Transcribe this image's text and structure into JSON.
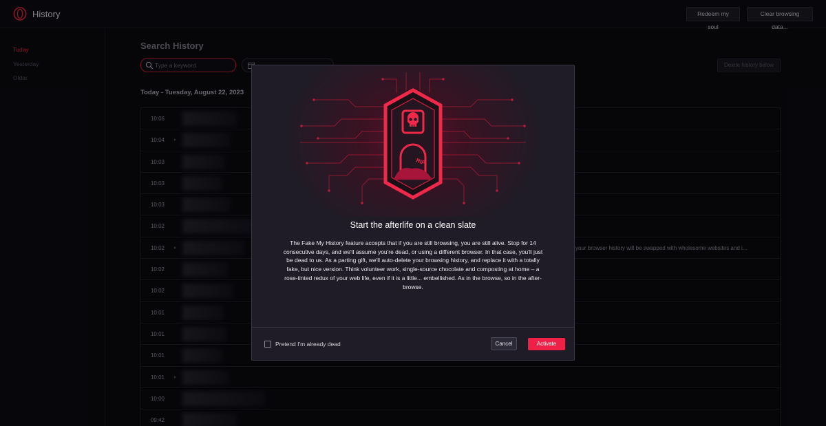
{
  "header": {
    "title": "History",
    "redeem_label": "Redeem my soul",
    "clear_label": "Clear browsing data..."
  },
  "sidebar": {
    "items": [
      {
        "label": "Today",
        "active": true
      },
      {
        "label": "Yesterday",
        "active": false
      },
      {
        "label": "Older",
        "active": false
      }
    ]
  },
  "main": {
    "title": "Search History",
    "search_placeholder": "Type a keyword",
    "delete_below_label": "Delete history below",
    "day_heading": "Today - Tuesday, August 22, 2023",
    "rows": [
      {
        "time": "10:06",
        "expandable": false,
        "text": ""
      },
      {
        "time": "10:04",
        "expandable": true,
        "text": ""
      },
      {
        "time": "10:03",
        "expandable": false,
        "text": ""
      },
      {
        "time": "10:03",
        "expandable": false,
        "text": ""
      },
      {
        "time": "10:03",
        "expandable": false,
        "text": ""
      },
      {
        "time": "10:02",
        "expandable": false,
        "text": ""
      },
      {
        "time": "10:02",
        "expandable": true,
        "text": "your browser history will be swapped with wholesome websites and i..."
      },
      {
        "time": "10:02",
        "expandable": false,
        "text": ""
      },
      {
        "time": "10:02",
        "expandable": false,
        "text": ""
      },
      {
        "time": "10:01",
        "expandable": false,
        "text": ""
      },
      {
        "time": "10:01",
        "expandable": false,
        "text": ""
      },
      {
        "time": "10:01",
        "expandable": false,
        "text": ""
      },
      {
        "time": "10:01",
        "expandable": true,
        "text": ""
      },
      {
        "time": "10:00",
        "expandable": false,
        "text": ""
      },
      {
        "time": "09:42",
        "expandable": false,
        "text": ""
      }
    ]
  },
  "modal": {
    "badge_text": "RIP",
    "title": "Start the afterlife on a clean slate",
    "description": "The Fake My History feature accepts that if you are still browsing, you are still alive. Stop for 14 consecutive days, and we'll assume you're dead, or using a different browser. In that case, you'll just be dead to us. As a parting gift, we'll auto-delete your browsing history, and replace it with a totally fake, but nice version. Think volunteer work, single-source chocolate and composting at home – a rose-tinted redux of your web life, even if it is a little... embellished. As in the browse, so in the after-browse.",
    "checkbox_label": "Pretend I'm already dead",
    "checkbox_checked": false,
    "cancel_label": "Cancel",
    "activate_label": "Activate"
  },
  "colors": {
    "accent": "#ef2046",
    "background": "#0b0a10",
    "modal_bg": "#1f1c27"
  },
  "icons": {
    "logo": "opera-logo-icon",
    "search": "search-icon",
    "date": "calendar-icon",
    "skull": "skull-icon",
    "tombstone": "tombstone-icon"
  }
}
